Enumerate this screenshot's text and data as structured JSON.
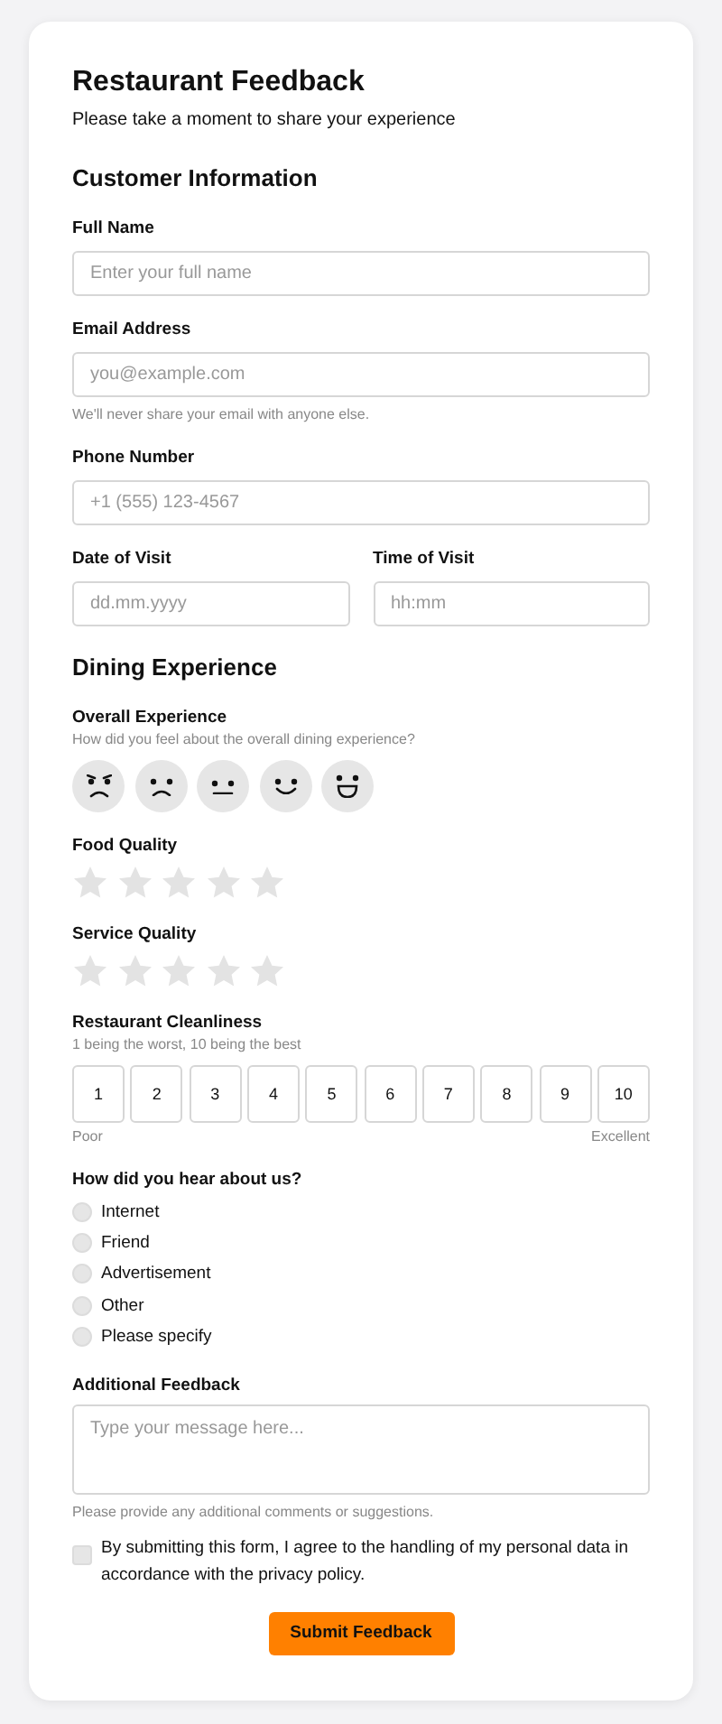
{
  "title": "Restaurant Feedback",
  "subtitle": "Please take a moment to share your experience",
  "sections": [
    {
      "heading": "Customer Information",
      "fields": [
        {
          "kind": "input",
          "label": "Full Name",
          "placeholder": "Enter your full name"
        },
        {
          "kind": "input",
          "label": "Email Address",
          "placeholder": "you@example.com",
          "hint": "We'll never share your email with anyone else."
        },
        {
          "kind": "input",
          "label": "Phone Number",
          "placeholder": "+1 (555) 123-4567"
        },
        {
          "kind": "pair",
          "fields": [
            {
              "label": "Date of Visit",
              "placeholder": "dd.mm.yyyy"
            },
            {
              "label": "Time of Visit",
              "placeholder": "hh:mm"
            }
          ]
        }
      ]
    },
    {
      "heading": "Dining Experience",
      "fields": [
        {
          "kind": "faces",
          "label": "Overall Experience",
          "description": "How did you feel about the overall dining experience?",
          "faces": [
            {
              "kind": "angry",
              "selected": false
            },
            {
              "kind": "sad",
              "selected": false
            },
            {
              "kind": "neutral",
              "selected": false
            },
            {
              "kind": "smile",
              "selected": false
            },
            {
              "kind": "grin",
              "selected": false
            }
          ]
        },
        {
          "kind": "stars",
          "label": "Food Quality",
          "stars": 0
        },
        {
          "kind": "stars",
          "label": "Service Quality",
          "stars": 0
        },
        {
          "kind": "scale",
          "label": "Restaurant Cleanliness",
          "description": "1 being the worst, 10 being the best",
          "low": "Poor",
          "high": "Excellent",
          "options": [
            {
              "label": "1",
              "selected": false
            },
            {
              "label": "2",
              "selected": false
            },
            {
              "label": "3",
              "selected": false
            },
            {
              "label": "4",
              "selected": false
            },
            {
              "label": "5",
              "selected": false
            },
            {
              "label": "6",
              "selected": false
            },
            {
              "label": "7",
              "selected": false
            },
            {
              "label": "8",
              "selected": false
            },
            {
              "label": "9",
              "selected": false
            },
            {
              "label": "10",
              "selected": false
            }
          ]
        },
        {
          "kind": "radio",
          "label": "How did you hear about us?",
          "options": [
            {
              "label": "Internet",
              "selected": false
            },
            {
              "label": "Friend",
              "selected": false
            },
            {
              "label": "Advertisement",
              "selected": false
            },
            {
              "label": "Other",
              "selected": false
            },
            {
              "label": "Please specify",
              "selected": false
            }
          ]
        },
        {
          "kind": "textarea",
          "label": "Additional Feedback",
          "placeholder": "Type your message here...",
          "hint": "Please provide any additional comments or suggestions."
        }
      ]
    }
  ],
  "consent": {
    "text": "By submitting this form, I agree to the handling of my personal data in accordance with the privacy policy.",
    "checked": false
  },
  "submit": {
    "label": "Submit Feedback"
  }
}
